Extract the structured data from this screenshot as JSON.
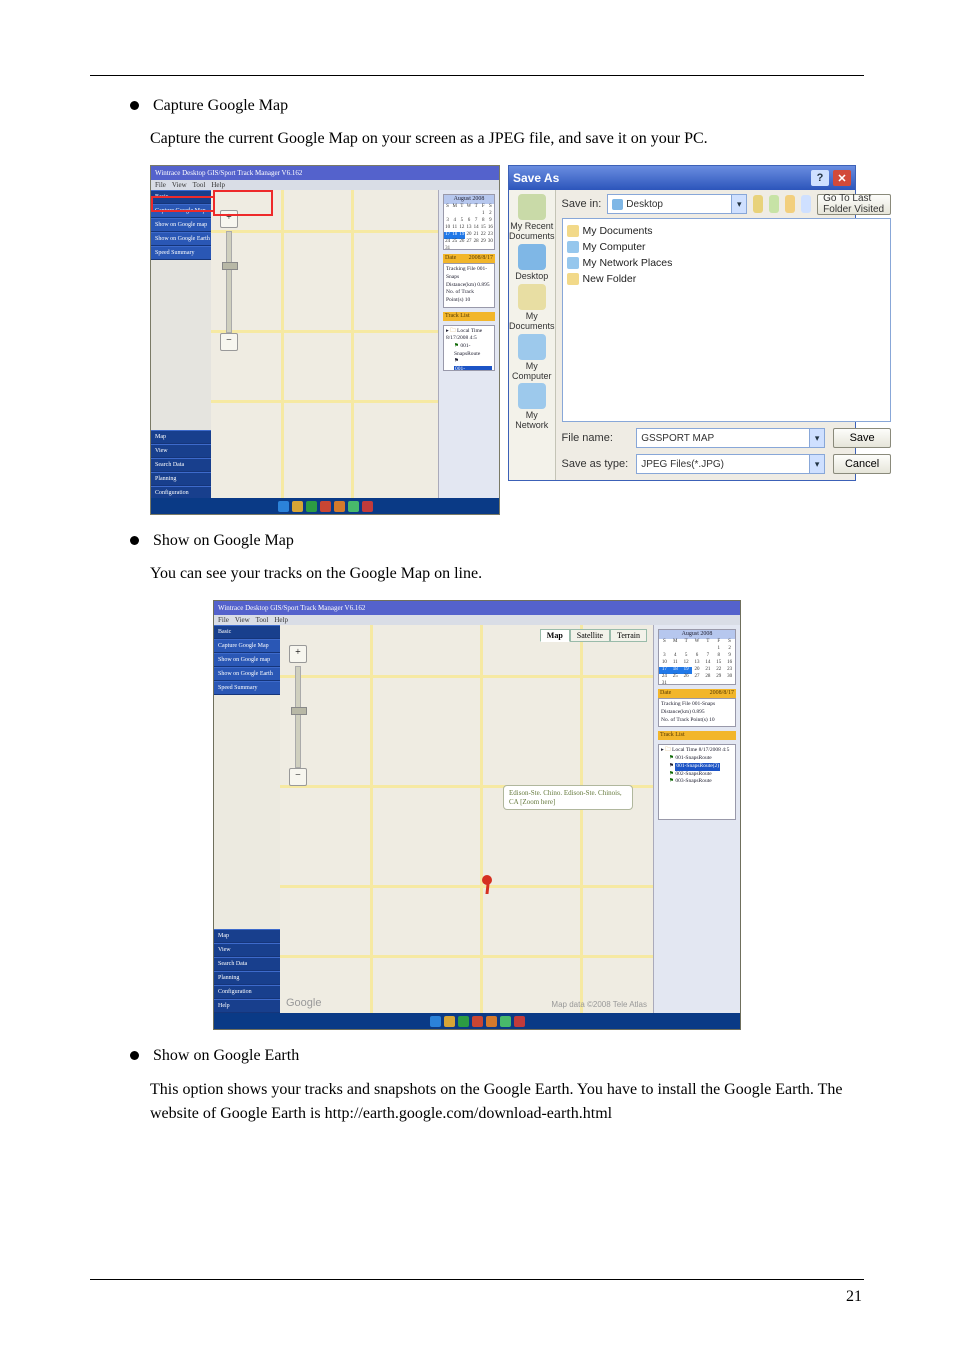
{
  "bullets": {
    "capture": "Capture Google Map",
    "showMap": "Show on Google Map",
    "showEarth": "Show on Google Earth"
  },
  "paras": {
    "capture": "Capture the current Google Map on your screen as a JPEG file, and save it on your PC.",
    "showMap": "You can see your tracks on the Google Map on line.",
    "showEarth": "This option shows your tracks and snapshots on the Google Earth. You have to install the Google Earth. The website of Google Earth is http://earth.google.com/download-earth.html"
  },
  "app": {
    "left_title": "Wintrace Desktop GIS/Sport Track Manager V6.162",
    "menus": [
      "File",
      "View",
      "Tool",
      "Help"
    ],
    "sidebar_top": [
      "Basic",
      "Capture Google Map",
      "Show on Google map",
      "Show on Google Earth",
      "Speed Summary"
    ],
    "sidebar_bottom": [
      "Map",
      "View",
      "Search Data",
      "Planning",
      "Configuration",
      "Help"
    ],
    "task_colors": [
      "#2b82d9",
      "#d7a536",
      "#2c9c43",
      "#c94633",
      "#d47a2c",
      "#48b96b",
      "#c23b3b"
    ]
  },
  "calendar": {
    "month": "August    2008",
    "days": [
      "Sun",
      "Mon",
      "Tue",
      "Wed",
      "Thu",
      "Fri",
      "Sat"
    ],
    "selected_range": [
      17,
      19
    ]
  },
  "trackinfo": {
    "headerLeft": "Date",
    "headerRight": "2008/8/17",
    "rows": [
      [
        "Tracking File",
        "001-Snaps"
      ],
      [
        "Distance(km)",
        "0.895"
      ],
      [
        "No. of Track Point(s)",
        "10"
      ]
    ]
  },
  "tracklist": {
    "header": "Track List",
    "root": "Local Time 8/17/2008 4:5",
    "items": [
      "001-SnapsRoute",
      "001-SnapsRoute(2)",
      "002-SnapsRoute",
      "003-SnapsRoute"
    ]
  },
  "saveas": {
    "title": "Save As",
    "savein_label": "Save in:",
    "savein_value": "Desktop",
    "go_last": "Go To Last Folder Visited",
    "places": [
      "My Recent Documents",
      "Desktop",
      "My Documents",
      "My Computer",
      "My Network"
    ],
    "place_colors": [
      "#c9daa8",
      "#7fb7e6",
      "#e8dea3",
      "#9dc9ec",
      "#9dc9ec"
    ],
    "listing": [
      {
        "label": "My Documents",
        "color": "#f2d989"
      },
      {
        "label": "My Computer",
        "color": "#96c7ed"
      },
      {
        "label": "My Network Places",
        "color": "#96c7ed"
      },
      {
        "label": "New Folder",
        "color": "#f2d989"
      }
    ],
    "filename_label": "File name:",
    "filename_value": "GSSPORT MAP",
    "type_label": "Save as type:",
    "type_value": "JPEG Files(*.JPG)",
    "save_btn": "Save",
    "cancel_btn": "Cancel"
  },
  "bigmap": {
    "tabs": [
      "Map",
      "Satellite",
      "Terrain"
    ],
    "balloon": "Edison-Ste. Chino. Edison-Ste.\nChinois, CA\n[Zoom here]",
    "logo": "Google",
    "attr": "Map data ©2008 Tele Atlas"
  },
  "page_number": "21"
}
